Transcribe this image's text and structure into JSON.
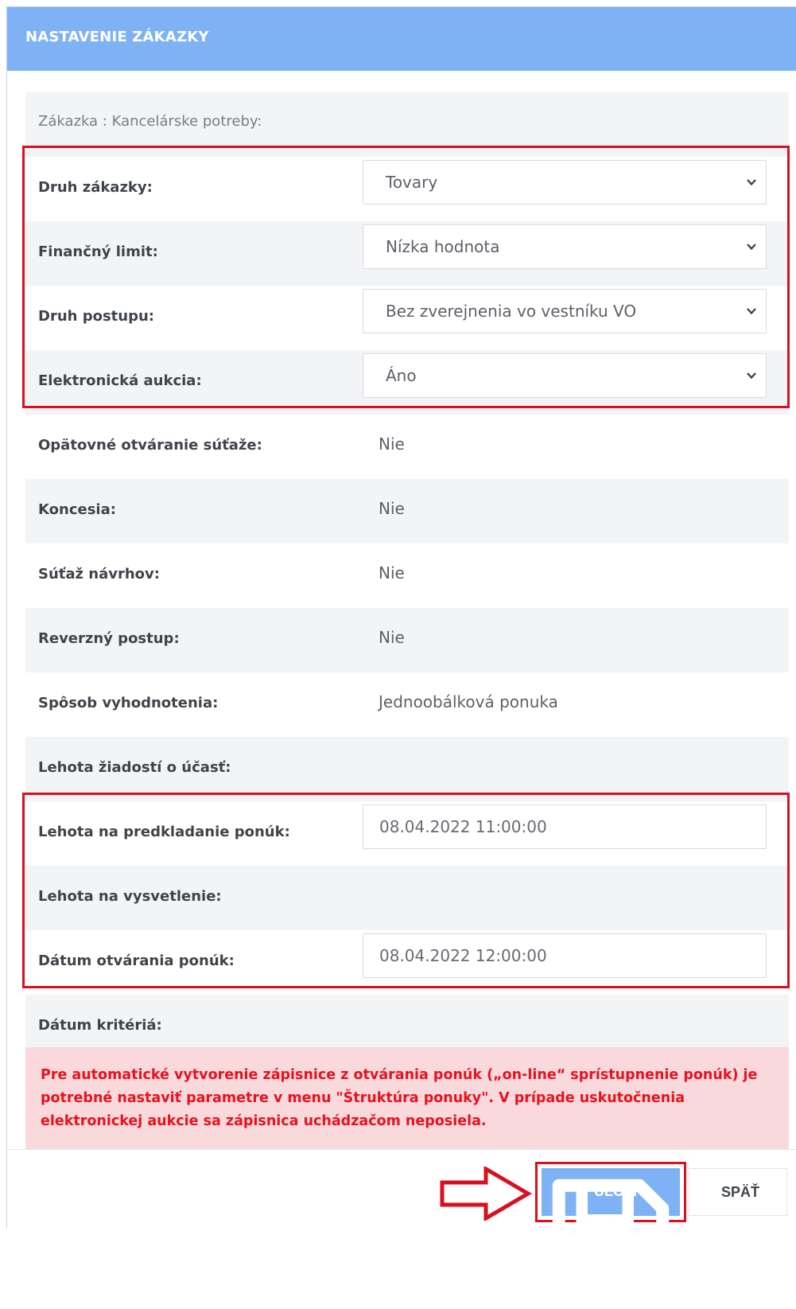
{
  "header": {
    "title": "NASTAVENIE ZÁKAZKY"
  },
  "caption": "Zákazka : Kancelárske potreby:",
  "fields": [
    {
      "label": "Druh zákazky:",
      "type": "select",
      "value": "Tovary"
    },
    {
      "label": "Finančný limit:",
      "type": "select",
      "value": "Nízka hodnota"
    },
    {
      "label": "Druh postupu:",
      "type": "select",
      "value": "Bez zverejnenia vo vestníku VO"
    },
    {
      "label": "Elektronická aukcia:",
      "type": "select",
      "value": "Áno"
    },
    {
      "label": "Opätovné otváranie súťaže:",
      "type": "text",
      "value": "Nie"
    },
    {
      "label": "Koncesia:",
      "type": "text",
      "value": "Nie"
    },
    {
      "label": "Súťaž návrhov:",
      "type": "text",
      "value": "Nie"
    },
    {
      "label": "Reverzný postup:",
      "type": "text",
      "value": "Nie"
    },
    {
      "label": "Spôsob vyhodnotenia:",
      "type": "text",
      "value": "Jednoobálková ponuka"
    },
    {
      "label": "Lehota žiadostí o účasť:",
      "type": "empty",
      "value": ""
    },
    {
      "label": "Lehota na predkladanie ponúk:",
      "type": "input",
      "value": "08.04.2022 11:00:00"
    },
    {
      "label": "Lehota na vysvetlenie:",
      "type": "empty",
      "value": ""
    },
    {
      "label": "Dátum otvárania ponúk:",
      "type": "input",
      "value": "08.04.2022 12:00:00"
    },
    {
      "label": "Dátum kritériá:",
      "type": "empty",
      "value": ""
    }
  ],
  "alert": {
    "text": "Pre automatické vytvorenie zápisnice z otvárania ponúk („on-line“ sprístupnenie ponúk) je potrebné nastaviť parametre v menu \"Štruktúra ponuky\". V prípade uskutočnenia elektronickej aukcie sa zápisnica uchádzačom neposiela."
  },
  "buttons": {
    "save": "ULOŽIŤ",
    "back": "SPÄŤ"
  },
  "icons": {
    "save": "floppy-disk-icon",
    "select": "chevron-down-icon",
    "annotation": "arrow-right-icon"
  },
  "colors": {
    "header": "#7fb2f5",
    "accent": "#7fb2f5",
    "highlight": "#d8101f",
    "alert_bg": "#f9d9dc",
    "alert_text": "#e8121e"
  }
}
